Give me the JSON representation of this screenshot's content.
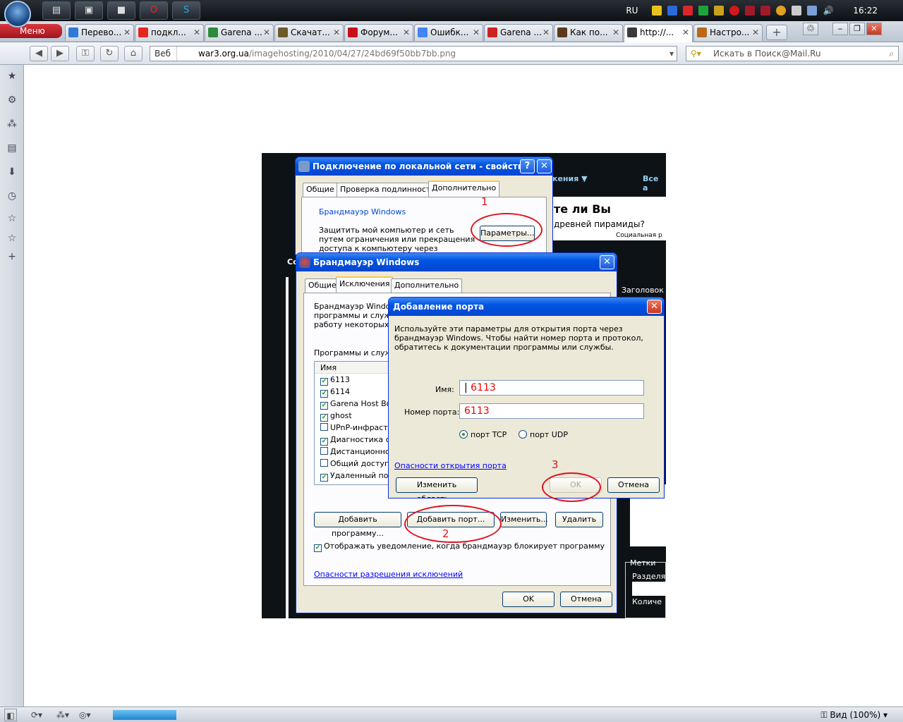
{
  "taskbar": {
    "tray_lang": "RU",
    "clock": "16:22"
  },
  "browser": {
    "menu_label": "Меню",
    "tabs": [
      {
        "label": "Перево...",
        "color": "#2d7bd6"
      },
      {
        "label": "подкл...",
        "color": "#e52620"
      },
      {
        "label": "Garena ...",
        "color": "#2e8b3e"
      },
      {
        "label": "Скачат...",
        "color": "#6b5a2a"
      },
      {
        "label": "Форум...",
        "color": "#c8101a"
      },
      {
        "label": "Ошибк...",
        "color": "#4285f4"
      },
      {
        "label": "Garena ...",
        "color": "#c22"
      },
      {
        "label": "Как по...",
        "color": "#5a3a1a"
      },
      {
        "label": "http://...",
        "color": "#3a3a3a"
      },
      {
        "label": "Настро...",
        "color": "#b86a1a"
      }
    ],
    "active_tab_index": 8,
    "address_prefix": "Веб",
    "url_domain": "war3.org.ua",
    "url_path": "/imagehosting/2010/04/27/24bd69f50bb7bb.png",
    "search_placeholder": "Искать в Поиск@Mail.Ru",
    "zoom_label": "Вид (100%)"
  },
  "page": {
    "bg_texts": [
      "кения ▼",
      "Все а",
      "те ли Вы",
      "древней пирамиды?",
      "Социальная р",
      "Со",
      "Заголовок",
      "Метки",
      "Разделя",
      "Количе"
    ]
  },
  "dialog_lan": {
    "title": "Подключение по локальной сети - свойства",
    "tabs": [
      "Общие",
      "Проверка подлинности",
      "Дополнительно"
    ],
    "group_label": "Брандмауэр Windows",
    "description": "Защитить мой компьютер и сеть путем ограничения или прекращения доступа к компьютеру через Интернет",
    "params_button": "Параметры..."
  },
  "dialog_fw": {
    "title": "Брандмауэр Windows",
    "tabs": [
      "Общие",
      "Исключения",
      "Дополнительно"
    ],
    "intro": "Брандмауэр Windows\nпрограммы и служб\nработу некоторых пр",
    "list_caption": "Программы и служб",
    "column_name": "Имя",
    "items": [
      {
        "label": "6113",
        "checked": true
      },
      {
        "label": "6114",
        "checked": true
      },
      {
        "label": "Garena Host Bot",
        "checked": true
      },
      {
        "label": "ghost",
        "checked": true
      },
      {
        "label": "UPnP-инфрастру",
        "checked": false
      },
      {
        "label": "Диагностика се",
        "checked": true
      },
      {
        "label": "Дистанционное",
        "checked": false
      },
      {
        "label": "Общий доступ к",
        "checked": false
      },
      {
        "label": "Удаленный пом",
        "checked": true
      }
    ],
    "btn_add_program": "Добавить программу...",
    "btn_add_port": "Добавить порт...",
    "btn_edit": "Изменить...",
    "btn_delete": "Удалить",
    "notify_label": "Отображать уведомление, когда брандмауэр блокирует программу",
    "link": "Опасности разрешения исключений",
    "ok": "OK",
    "cancel": "Отмена"
  },
  "dialog_port": {
    "title": "Добавление порта",
    "description": "Используйте эти параметры для открытия порта через брандмауэр Windows. Чтобы найти номер порта и протокол, обратитесь к документации программы или службы.",
    "name_label": "Имя:",
    "name_value": "6113",
    "port_label": "Номер порта:",
    "port_value": "6113",
    "tcp_label": "порт TCP",
    "udp_label": "порт UDP",
    "link": "Опасности открытия порта",
    "change_scope": "Изменить область...",
    "ok": "OK",
    "cancel": "Отмена"
  },
  "annotations": [
    "1",
    "2",
    "3"
  ]
}
